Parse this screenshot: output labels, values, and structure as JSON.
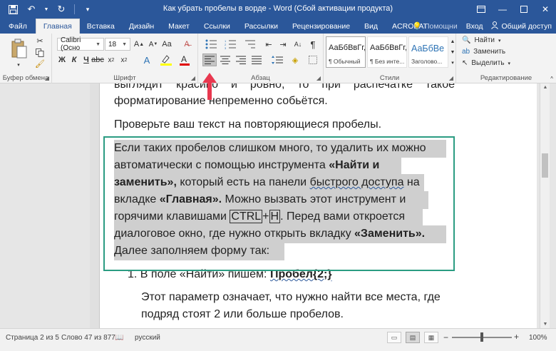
{
  "window": {
    "title": "Как убрать пробелы в ворде - Word (Сбой активации продукта)"
  },
  "tabs": [
    "Файл",
    "Главная",
    "Вставка",
    "Дизайн",
    "Макет",
    "Ссылки",
    "Рассылки",
    "Рецензирование",
    "Вид",
    "ACROBAT"
  ],
  "tabs_right": {
    "help": "Помощни",
    "signin": "Вход",
    "share": "Общий доступ"
  },
  "ribbon": {
    "clipboard_label": "Буфер обмена",
    "font_label": "Шрифт",
    "paragraph_label": "Абзац",
    "styles_label": "Стили",
    "editing_label": "Редактирование",
    "font_name": "Calibri (Осно",
    "font_size": "18",
    "bold": "Ж",
    "italic": "К",
    "underline": "Ч",
    "styles": [
      {
        "sample": "АаБбВвГг,",
        "name": "¶ Обычный"
      },
      {
        "sample": "АаБбВвГг,",
        "name": "¶ Без инте..."
      },
      {
        "sample": "АаБбВе",
        "name": "Заголово..."
      }
    ],
    "edit": {
      "find": "Найти",
      "replace": "Заменить",
      "select": "Выделить"
    }
  },
  "document": {
    "top_line_1": "выглядит красиво и ровно, то при распечатке такое",
    "top_line_2": "форматирование непременно собьётся.",
    "check_line": "Проверьте ваш текст на повторяющиеся пробелы.",
    "hl": {
      "l1": "Если таких пробелов слишком много, то удалить их можно",
      "l2a": "автоматически с помощью инструмента ",
      "l2b": "«Найти и",
      "l3a": "заменить»,",
      "l3b": " который есть на панели ",
      "l3c": "быстрого  доступа",
      "l3d": " на",
      "l4a": "вкладке ",
      "l4b": "«Главная».",
      "l4c": " Можно вызвать этот инструмент и",
      "l5a": "горячими клавишами ",
      "l5b": "CTRL",
      "l5c": "+",
      "l5d": "H",
      "l5e": ". Перед вами откроется",
      "l6a": "диалоговое окно, где нужно открыть вкладку ",
      "l6b": "«Заменить».",
      "l7": "Далее заполняем форму так:"
    },
    "list_item": {
      "number": "1.",
      "text": "В поле «Найти» пишем: ",
      "bold": "Пробел{2;}"
    },
    "after_1": "Этот параметр означает, что нужно найти все места, где",
    "after_2": "подряд стоят 2 или больше пробелов."
  },
  "status": {
    "page": "Страница 2 из 5",
    "words": "Слово 47 из 877",
    "lang": "русский",
    "zoom_minus": "−",
    "zoom_plus": "+",
    "zoom": "100%"
  }
}
